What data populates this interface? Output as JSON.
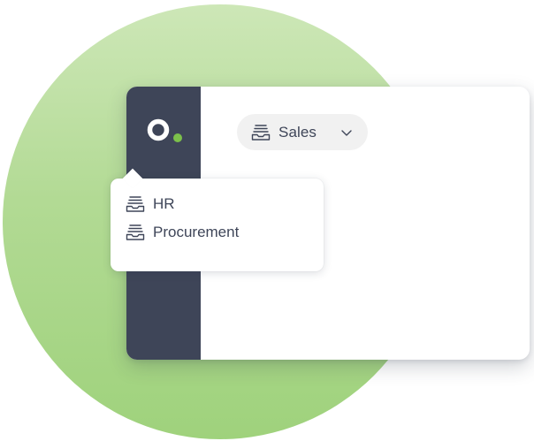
{
  "workspace_selector": {
    "selected": "Sales",
    "icon": "inbox-stack-icon",
    "expand_icon": "chevron-down-icon"
  },
  "dropdown": {
    "items": [
      {
        "label": "HR",
        "icon": "inbox-stack-icon"
      },
      {
        "label": "Procurement",
        "icon": "inbox-stack-icon"
      }
    ]
  },
  "colors": {
    "sidebar": "#3e4558",
    "accent_green": "#7cc04b",
    "background_circle": "#b2da94",
    "text": "#3e4558"
  }
}
